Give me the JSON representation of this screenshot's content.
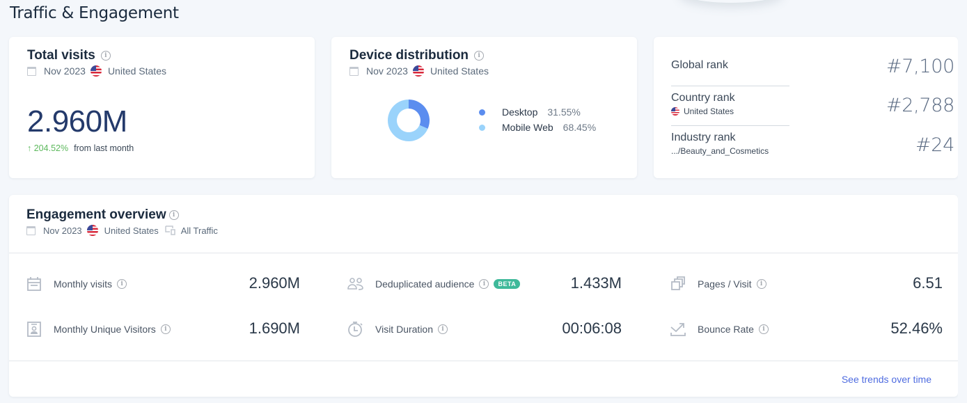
{
  "section_title": "Traffic & Engagement",
  "filters": {
    "date": "Nov 2023",
    "country": "United States",
    "traffic": "All Traffic"
  },
  "total_visits": {
    "title": "Total visits",
    "value": "2.960M",
    "change_arrow": "↑",
    "change_pct": "204.52%",
    "change_text": "from last month",
    "change_color": "#5cb85c"
  },
  "device_distribution": {
    "title": "Device distribution",
    "segments": [
      {
        "label": "Desktop",
        "value_text": "31.55%",
        "color": "#5b8def"
      },
      {
        "label": "Mobile Web",
        "value_text": "68.45%",
        "color": "#9ad3fb"
      }
    ]
  },
  "chart_data": {
    "type": "pie",
    "title": "Device distribution",
    "categories": [
      "Desktop",
      "Mobile Web"
    ],
    "values": [
      31.55,
      68.45
    ],
    "colors": [
      "#5b8def",
      "#9ad3fb"
    ],
    "donut": true,
    "legend": "right"
  },
  "ranks": [
    {
      "label": "Global rank",
      "sub": "",
      "value": "#7,100"
    },
    {
      "label": "Country rank",
      "sub": "United States",
      "value": "#2,788",
      "flag": true
    },
    {
      "label": "Industry rank",
      "sub": ".../Beauty_and_Cosmetics",
      "value": "#24"
    }
  ],
  "engagement": {
    "title": "Engagement overview",
    "beta_label": "BETA",
    "metrics": [
      {
        "label": "Monthly visits",
        "value": "2.960M",
        "icon": "calendar-icon"
      },
      {
        "label": "Deduplicated audience",
        "value": "1.433M",
        "icon": "people-icon"
      },
      {
        "label": "Pages / Visit",
        "value": "6.51",
        "icon": "pages-icon"
      },
      {
        "label": "Monthly Unique Visitors",
        "value": "1.690M",
        "icon": "id-badge-icon"
      },
      {
        "label": "Visit Duration",
        "value": "00:06:08",
        "icon": "stopwatch-icon"
      },
      {
        "label": "Bounce Rate",
        "value": "52.46%",
        "icon": "bounce-arrow-icon"
      }
    ],
    "link_label": "See trends over time",
    "link_color": "#4f6ce0"
  },
  "info_glyph": "i"
}
